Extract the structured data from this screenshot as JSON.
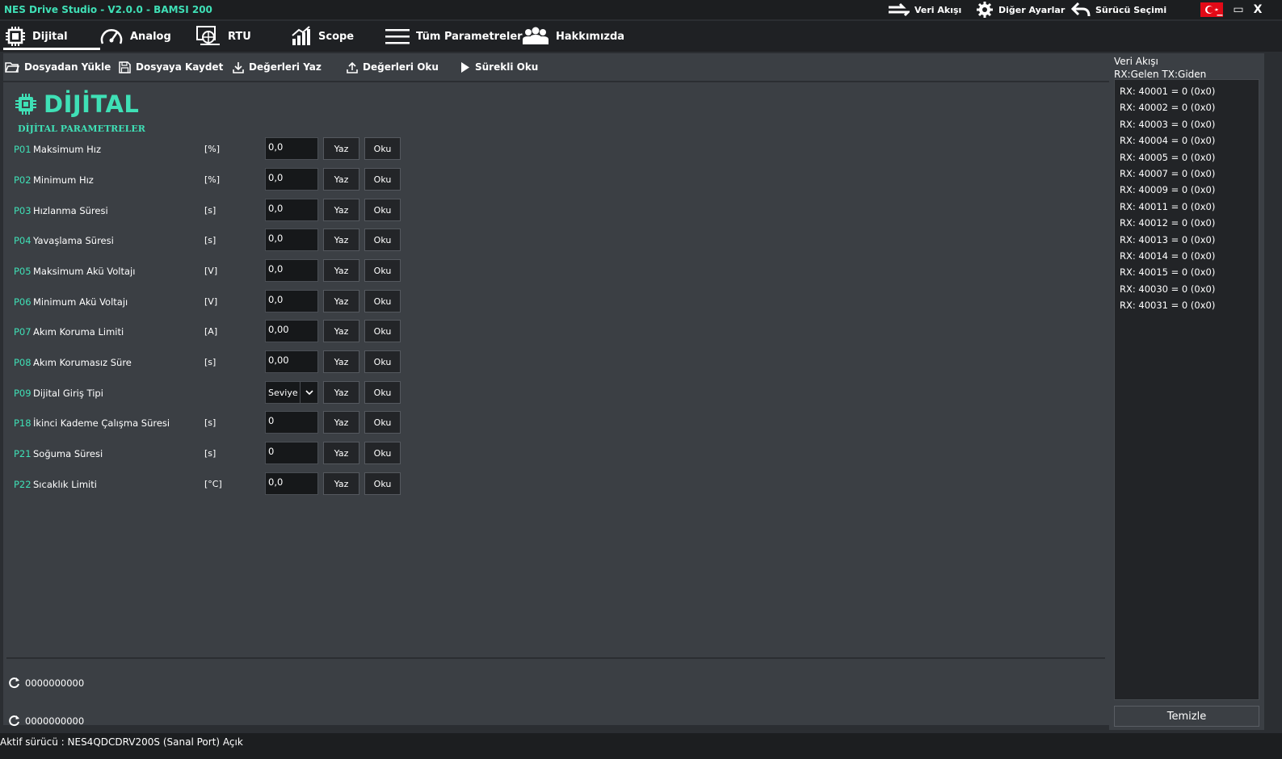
{
  "titlebar": {
    "title": "NES Drive Studio - V2.0.0 - BAMSI 200",
    "items": [
      {
        "label": "Veri Akışı",
        "icon": "swap-arrows-icon"
      },
      {
        "label": "Diğer Ayarlar",
        "icon": "gear-icon"
      },
      {
        "label": "Sürücü Seçimi",
        "icon": "back-arrow-icon"
      }
    ],
    "flag_icon": "turkish-flag-icon",
    "window_buttons": {
      "minimize": "_",
      "maximize": "▭",
      "close": "X"
    }
  },
  "tabs": [
    {
      "label": "Dijital",
      "icon": "chip-icon",
      "active": true
    },
    {
      "label": "Analog",
      "icon": "gauge-icon",
      "active": false
    },
    {
      "label": "RTU",
      "icon": "network-icon",
      "active": false
    },
    {
      "label": "Scope",
      "icon": "bar-chart-icon",
      "active": false
    },
    {
      "label": "Tüm Parametreler",
      "icon": "menu-icon",
      "active": false
    },
    {
      "label": "Hakkımızda",
      "icon": "users-icon",
      "active": false
    }
  ],
  "toolbar": {
    "load": "Dosyadan Yükle",
    "save": "Dosyaya Kaydet",
    "write": "Değerleri Yaz",
    "read": "Değerleri Oku",
    "continuous": "Sürekli Oku"
  },
  "page": {
    "title": "DİJİTAL",
    "section": "DİJİTAL PARAMETRELER"
  },
  "buttons": {
    "write": "Yaz",
    "read": "Oku"
  },
  "params": [
    {
      "code": "P01",
      "name": "Maksimum Hız",
      "unit": "[%]",
      "value": "0,0"
    },
    {
      "code": "P02",
      "name": "Minimum Hız",
      "unit": "[%]",
      "value": "0,0"
    },
    {
      "code": "P03",
      "name": "Hızlanma Süresi",
      "unit": "[s]",
      "value": "0,0"
    },
    {
      "code": "P04",
      "name": "Yavaşlama Süresi",
      "unit": "[s]",
      "value": "0,0"
    },
    {
      "code": "P05",
      "name": "Maksimum Akü Voltajı",
      "unit": "[V]",
      "value": "0,0"
    },
    {
      "code": "P06",
      "name": "Minimum Akü Voltajı",
      "unit": "[V]",
      "value": "0,0"
    },
    {
      "code": "P07",
      "name": "Akım Koruma Limiti",
      "unit": "[A]",
      "value": "0,00"
    },
    {
      "code": "P08",
      "name": "Akım Korumasız Süre",
      "unit": "[s]",
      "value": "0,00"
    },
    {
      "code": "P09",
      "name": "Dijital Giriş Tipi",
      "unit": "",
      "value": "Seviye",
      "type": "select"
    },
    {
      "code": "P18",
      "name": "İkinci Kademe Çalışma Süresi",
      "unit": "[s]",
      "value": "0"
    },
    {
      "code": "P21",
      "name": "Soğuma Süresi",
      "unit": "[s]",
      "value": "0"
    },
    {
      "code": "P22",
      "name": "Sıcaklık Limiti",
      "unit": "[°C]",
      "value": "0,0"
    }
  ],
  "counters": [
    "0000000000",
    "0000000000"
  ],
  "dataflow": {
    "title": "Veri Akışı",
    "subtitle": "RX:Gelen TX:Giden",
    "log": [
      "RX: 40001 = 0 (0x0)",
      "RX: 40002 = 0 (0x0)",
      "RX: 40003 = 0 (0x0)",
      "RX: 40004 = 0 (0x0)",
      "RX: 40005 = 0 (0x0)",
      "RX: 40007 = 0 (0x0)",
      "RX: 40009 = 0 (0x0)",
      "RX: 40011 = 0 (0x0)",
      "RX: 40012 = 0 (0x0)",
      "RX: 40013 = 0 (0x0)",
      "RX: 40014 = 0 (0x0)",
      "RX: 40015 = 0 (0x0)",
      "RX: 40030 = 0 (0x0)",
      "RX: 40031 = 0 (0x0)"
    ],
    "clear": "Temizle"
  },
  "statusbar": {
    "text": "Aktif sürücü : NES4QDCDRV200S (Sanal Port) Açık"
  },
  "colors": {
    "accent": "#3fe0b6",
    "background": "#3b3f44",
    "dark": "#1c1e20",
    "flag_red": "#e30a17"
  }
}
